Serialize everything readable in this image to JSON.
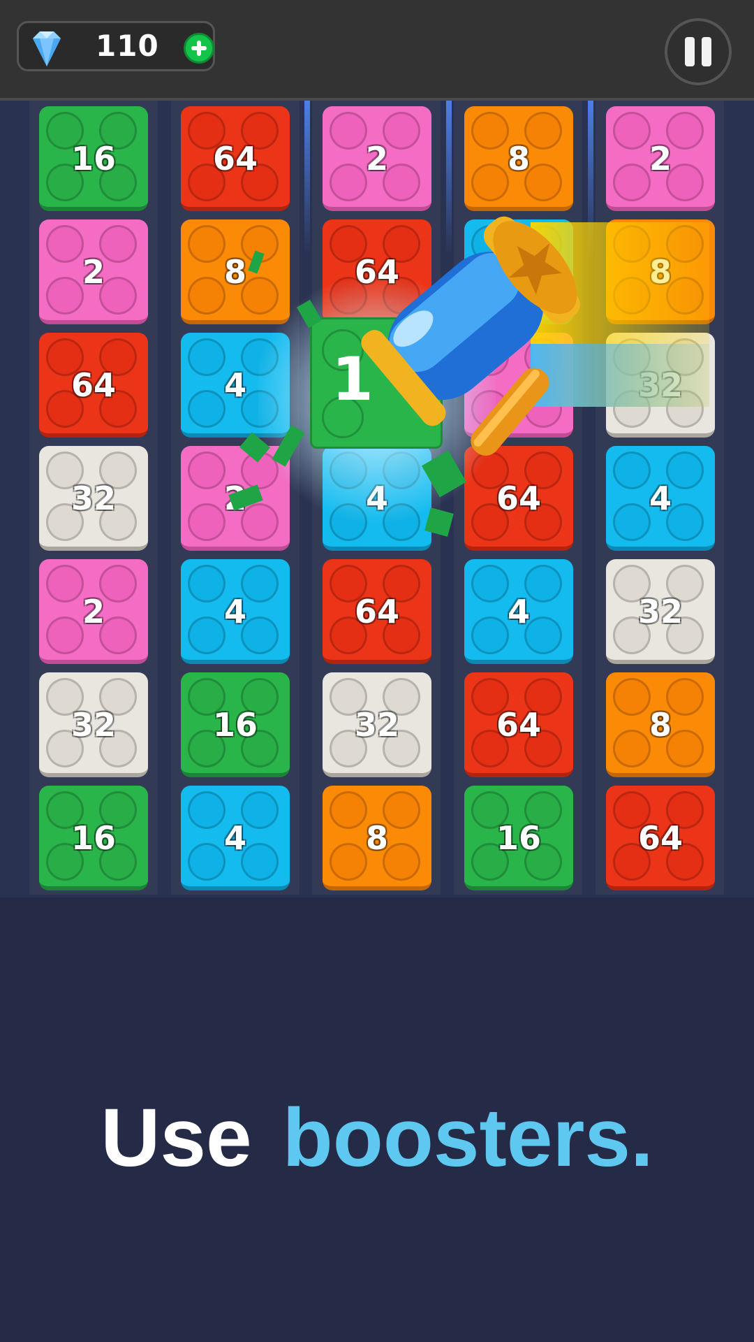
{
  "header": {
    "gem_count": "110",
    "gem_icon": "diamond-icon",
    "add_icon": "plus-icon",
    "pause_icon": "pause-icon"
  },
  "palette": {
    "green": {
      "face": "#2ab54b",
      "stud": "#28ad47",
      "edge": "#1c8436"
    },
    "red": {
      "face": "#ec3418",
      "stud": "#e42f15",
      "edge": "#b3230d"
    },
    "pink": {
      "face": "#f46cc3",
      "stud": "#ef62bc",
      "edge": "#c24b96"
    },
    "orange": {
      "face": "#fb8a06",
      "stud": "#f68205",
      "edge": "#c46603"
    },
    "blue": {
      "face": "#13bbef",
      "stud": "#0fb2e6",
      "edge": "#0a89b3"
    },
    "white": {
      "face": "#e9e6df",
      "stud": "#dedad2",
      "edge": "#aaa69d"
    }
  },
  "board": {
    "columns": [
      [
        {
          "value": "16",
          "color": "green"
        },
        {
          "value": "2",
          "color": "pink"
        },
        {
          "value": "64",
          "color": "red"
        },
        {
          "value": "32",
          "color": "white"
        },
        {
          "value": "2",
          "color": "pink"
        },
        {
          "value": "32",
          "color": "white"
        },
        {
          "value": "16",
          "color": "green"
        }
      ],
      [
        {
          "value": "64",
          "color": "red"
        },
        {
          "value": "8",
          "color": "orange"
        },
        {
          "value": "4",
          "color": "blue"
        },
        {
          "value": "2",
          "color": "pink"
        },
        {
          "value": "4",
          "color": "blue"
        },
        {
          "value": "16",
          "color": "green"
        },
        {
          "value": "4",
          "color": "blue"
        }
      ],
      [
        {
          "value": "2",
          "color": "pink"
        },
        {
          "value": "64",
          "color": "red"
        },
        {
          "value": "",
          "color": "green"
        },
        {
          "value": "4",
          "color": "blue"
        },
        {
          "value": "64",
          "color": "red"
        },
        {
          "value": "32",
          "color": "white"
        },
        {
          "value": "8",
          "color": "orange"
        }
      ],
      [
        {
          "value": "8",
          "color": "orange"
        },
        {
          "value": "",
          "color": "blue"
        },
        {
          "value": "",
          "color": "pink"
        },
        {
          "value": "64",
          "color": "red"
        },
        {
          "value": "4",
          "color": "blue"
        },
        {
          "value": "64",
          "color": "red"
        },
        {
          "value": "16",
          "color": "green"
        }
      ],
      [
        {
          "value": "2",
          "color": "pink"
        },
        {
          "value": "8",
          "color": "orange"
        },
        {
          "value": "32",
          "color": "white"
        },
        {
          "value": "4",
          "color": "blue"
        },
        {
          "value": "32",
          "color": "white"
        },
        {
          "value": "8",
          "color": "orange"
        },
        {
          "value": "64",
          "color": "red"
        }
      ]
    ]
  },
  "booster": {
    "icon": "hammer-icon",
    "breaking_tile_text": "1"
  },
  "caption": {
    "part1": "Use",
    "part2": "boosters."
  }
}
